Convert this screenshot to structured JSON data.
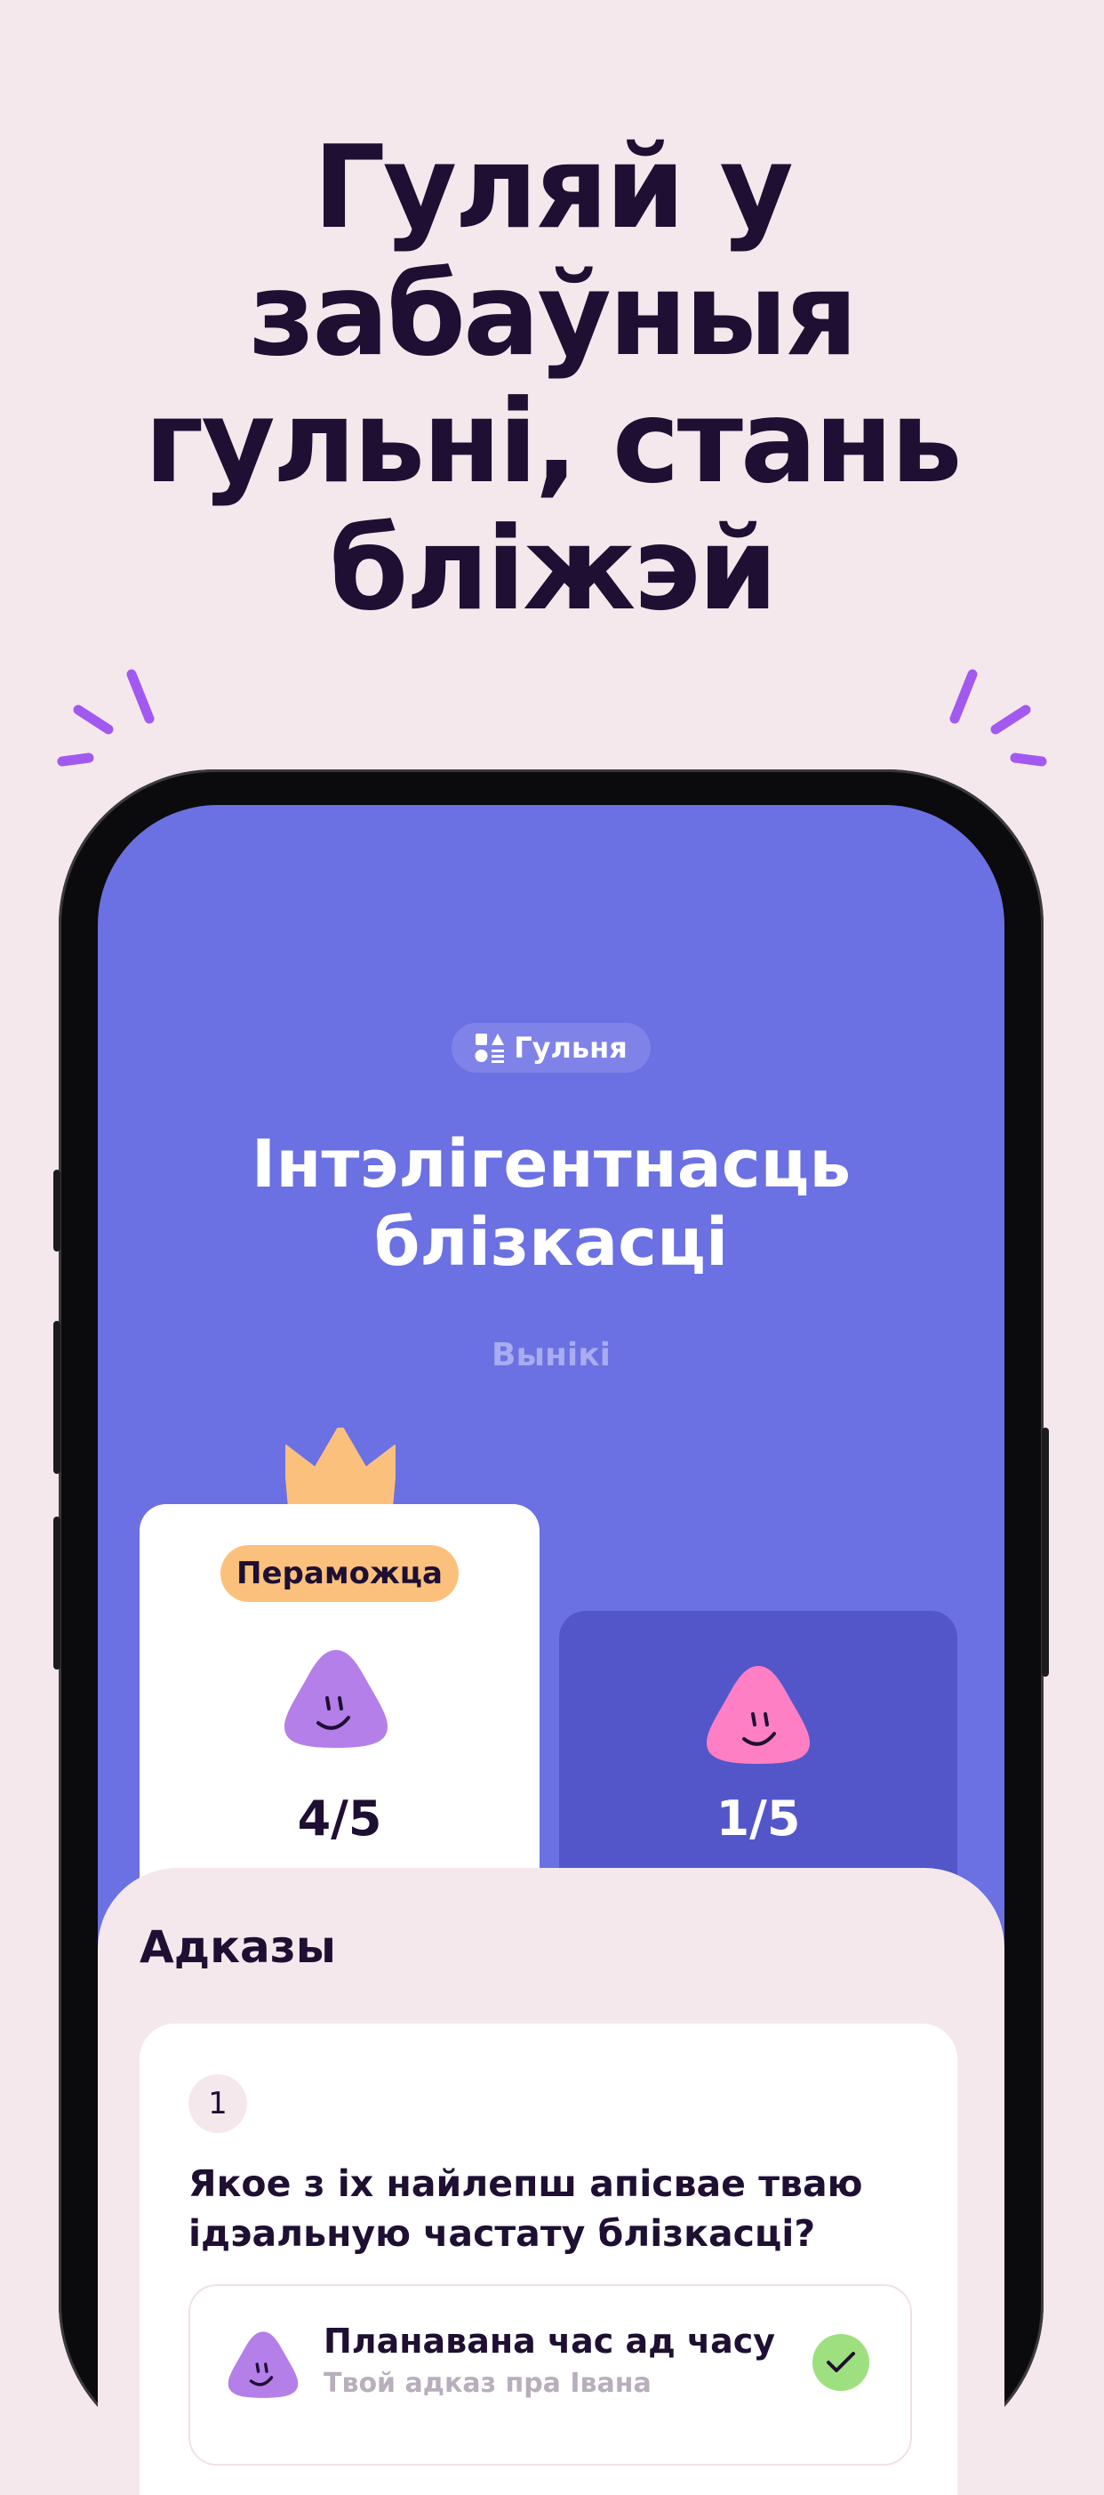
{
  "headline": {
    "lines": [
      "Гуляй у",
      "забаўныя",
      "гульні, стань",
      "бліжэй"
    ]
  },
  "screen": {
    "chip_label": "Гульня",
    "title_lines": [
      "Інтэлігентнасць",
      "блізкасці"
    ],
    "subtitle": "Вынікі",
    "winner": {
      "badge": "Пераможца",
      "score": "4/5",
      "avatar_color": "#b47fe8"
    },
    "other": {
      "score": "1/5",
      "avatar_color": "#ff7fc4"
    },
    "answers": {
      "title": "Адказы",
      "question_number": "1",
      "question_lines": [
        "Якое з іх найлепш апісвае тваю",
        "ідэальную частату блізкасці?"
      ],
      "answer_main": "Планавана час ад часу",
      "answer_sub": "Твой адказ пра Івана"
    }
  },
  "colors": {
    "background": "#f5e8ec",
    "screen": "#6b70e2",
    "accent": "#a259f0",
    "badge": "#fbc17c",
    "check": "#9ee07f"
  }
}
